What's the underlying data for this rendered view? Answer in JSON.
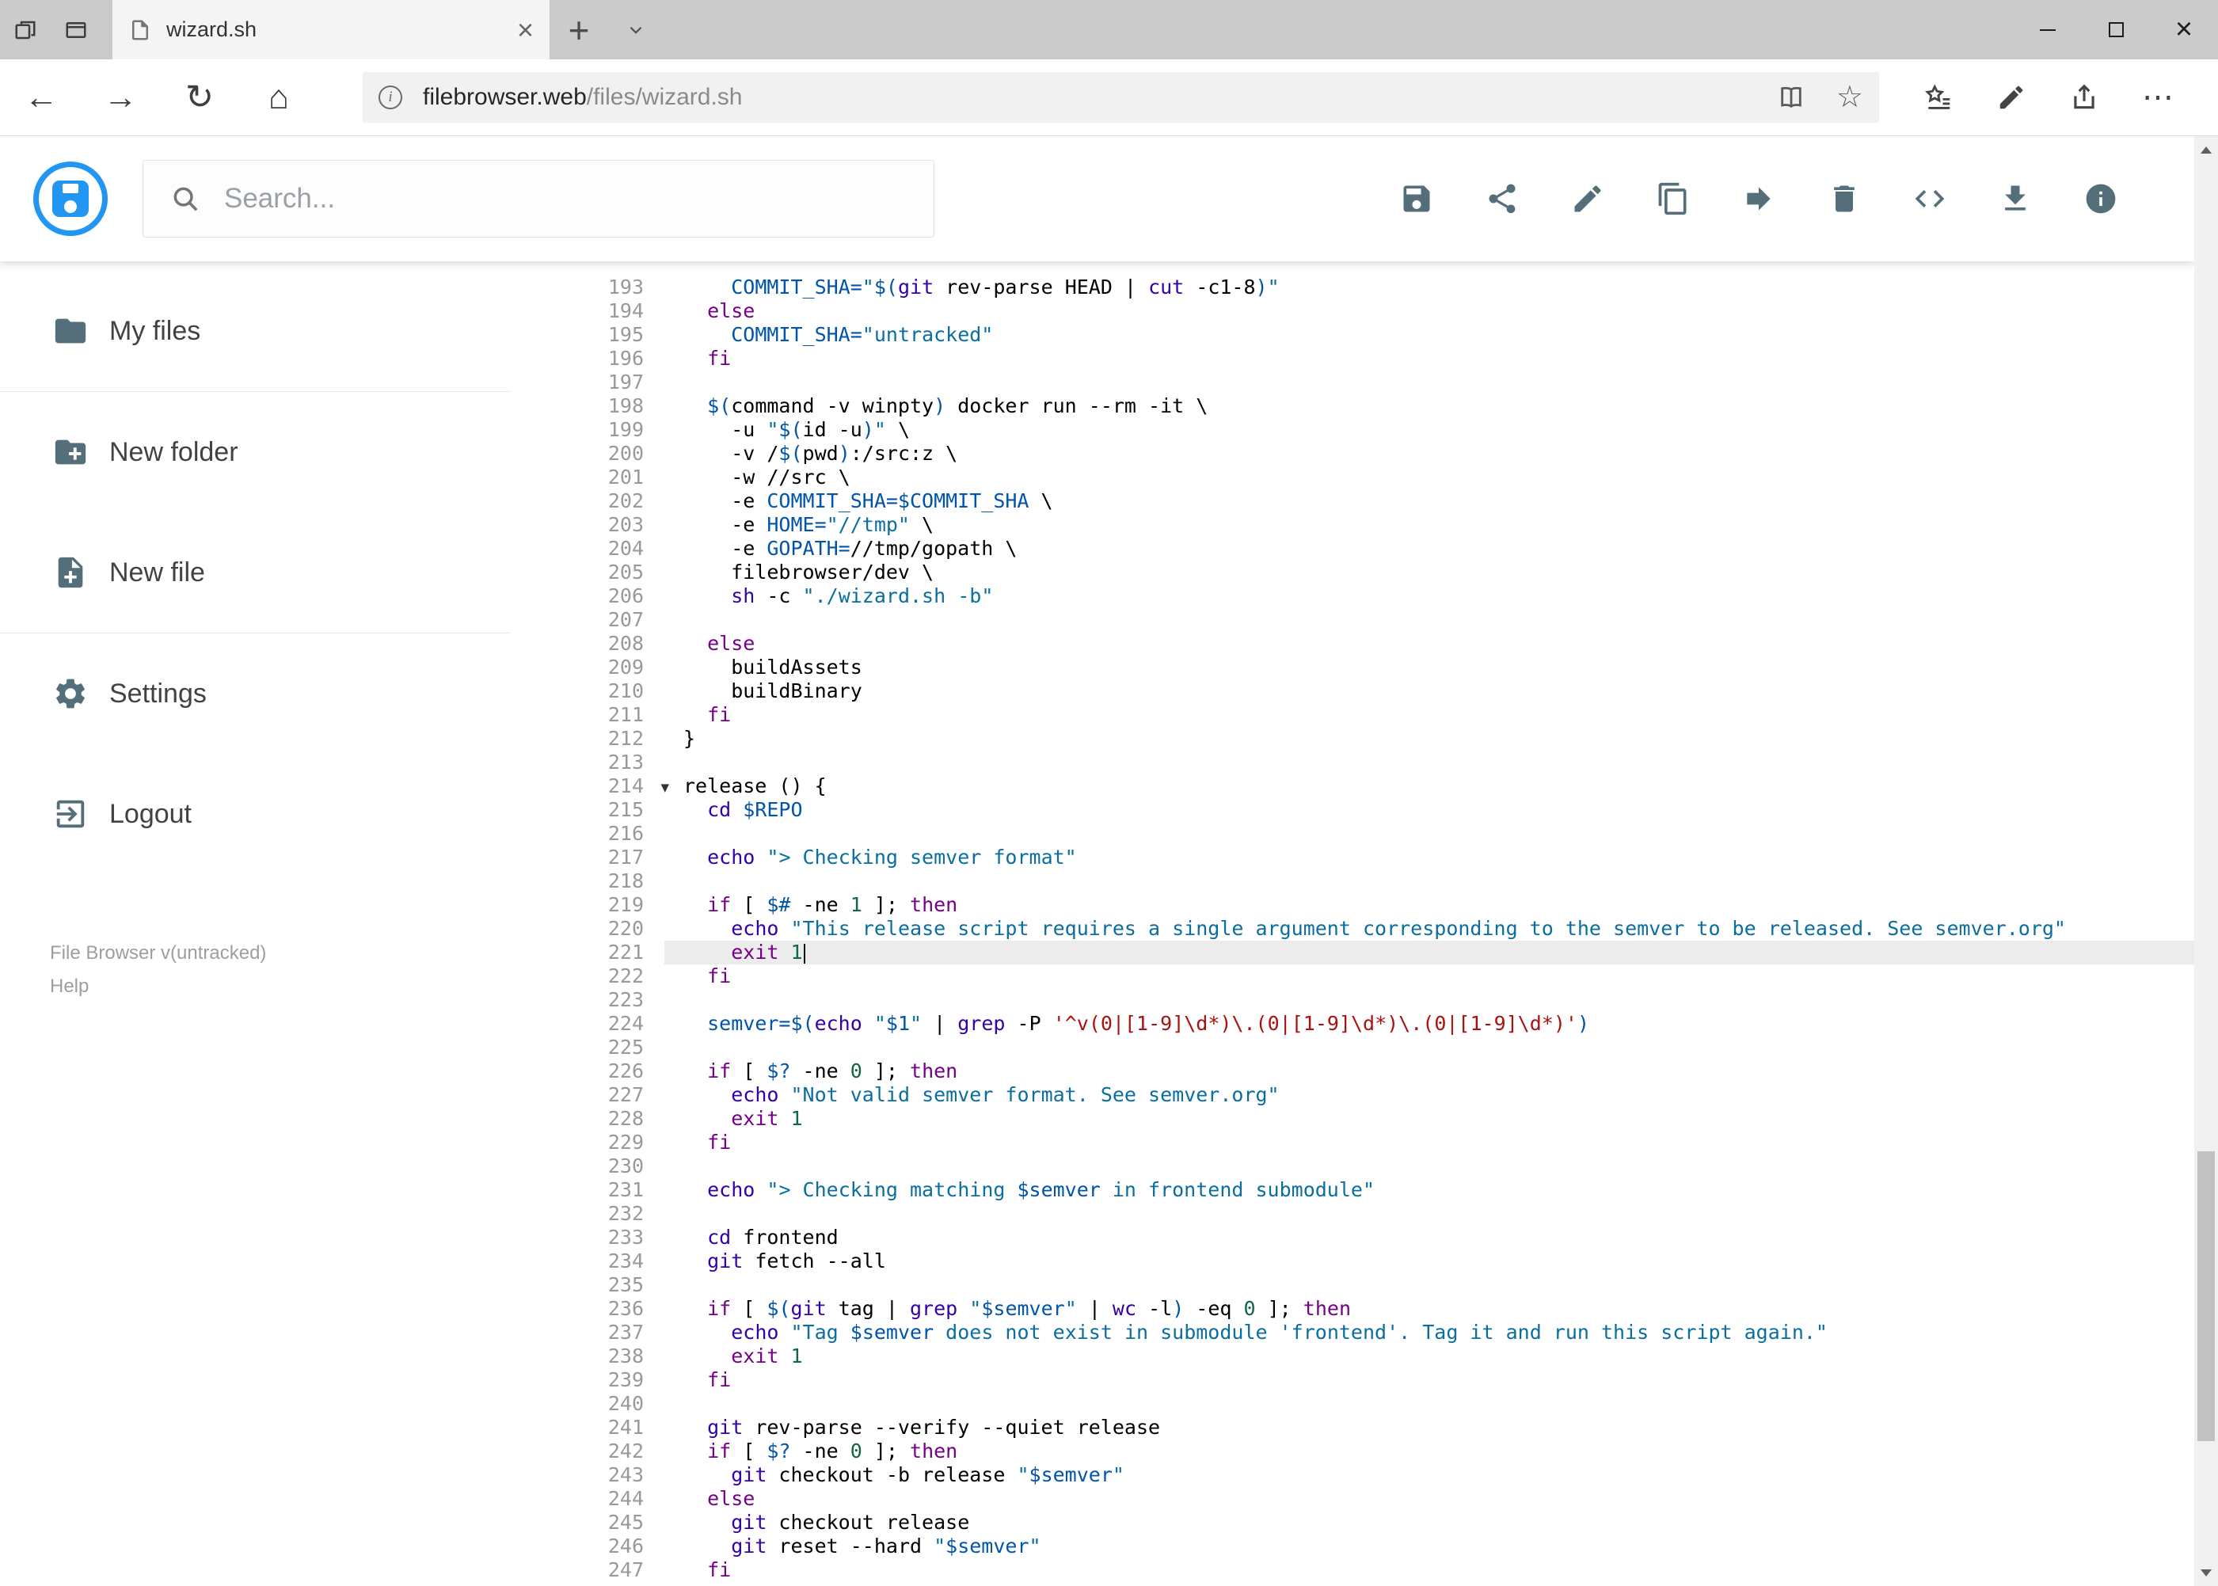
{
  "browser": {
    "tab_title": "wizard.sh",
    "url_domain": "filebrowser.web",
    "url_path": "/files/wizard.sh"
  },
  "icons": {
    "tab_close": "×",
    "new_tab": "+",
    "window_close": "×",
    "back": "←",
    "forward": "→",
    "refresh": "↻",
    "home": "⌂",
    "favorite_star": "☆",
    "ellipsis": "⋯",
    "fold_marker": "▾",
    "info_i": "i"
  },
  "header": {
    "search_placeholder": "Search...",
    "actions": [
      {
        "name": "save"
      },
      {
        "name": "share"
      },
      {
        "name": "edit"
      },
      {
        "name": "copy"
      },
      {
        "name": "move"
      },
      {
        "name": "delete"
      },
      {
        "name": "code"
      },
      {
        "name": "download"
      },
      {
        "name": "info"
      }
    ]
  },
  "sidebar": {
    "items": [
      {
        "label": "My files",
        "icon": "folder"
      },
      {
        "label": "New folder",
        "icon": "folder-plus"
      },
      {
        "label": "New file",
        "icon": "file-plus"
      },
      {
        "label": "Settings",
        "icon": "gear"
      },
      {
        "label": "Logout",
        "icon": "logout"
      }
    ],
    "dividers_after": [
      0,
      2
    ],
    "version": "File Browser v(untracked)",
    "help": "Help"
  },
  "colors": {
    "brand": "#2196f3",
    "header_icon": "#546e7a",
    "active_line_bg": "#ececec",
    "gutter": "#999999",
    "token_plain": "#000000",
    "token_keyword": "#770088",
    "token_variable": "#0055aa",
    "token_string": "#0a6ea0",
    "token_string_single": "#aa1111",
    "token_builtin": "#3300aa",
    "token_number": "#116644"
  },
  "editor": {
    "active_line": 221,
    "fold_line": 214,
    "lines": [
      {
        "n": 193,
        "s": [
          [
            "    ",
            "p"
          ],
          [
            "COMMIT_SHA=",
            "v"
          ],
          [
            "\"",
            "s"
          ],
          [
            "$(",
            "v"
          ],
          [
            "git",
            "b"
          ],
          [
            " rev-parse HEAD | ",
            "p"
          ],
          [
            "cut",
            "b"
          ],
          [
            " -c1-8",
            "p"
          ],
          [
            ")",
            "v"
          ],
          [
            "\"",
            "s"
          ]
        ]
      },
      {
        "n": 194,
        "s": [
          [
            "  ",
            "p"
          ],
          [
            "else",
            "k"
          ]
        ]
      },
      {
        "n": 195,
        "s": [
          [
            "    ",
            "p"
          ],
          [
            "COMMIT_SHA=",
            "v"
          ],
          [
            "\"untracked\"",
            "s"
          ]
        ]
      },
      {
        "n": 196,
        "s": [
          [
            "  ",
            "p"
          ],
          [
            "fi",
            "k"
          ]
        ]
      },
      {
        "n": 197,
        "s": []
      },
      {
        "n": 198,
        "s": [
          [
            "  ",
            "p"
          ],
          [
            "$(",
            "v"
          ],
          [
            "command -v winpty",
            "p"
          ],
          [
            ")",
            "v"
          ],
          [
            " docker run --rm -it \\",
            "p"
          ]
        ]
      },
      {
        "n": 199,
        "s": [
          [
            "    -u ",
            "p"
          ],
          [
            "\"",
            "s"
          ],
          [
            "$(",
            "v"
          ],
          [
            "id -u",
            "p"
          ],
          [
            ")",
            "v"
          ],
          [
            "\"",
            "s"
          ],
          [
            " \\",
            "p"
          ]
        ]
      },
      {
        "n": 200,
        "s": [
          [
            "    -v /",
            "p"
          ],
          [
            "$(",
            "v"
          ],
          [
            "pwd",
            "p"
          ],
          [
            ")",
            "v"
          ],
          [
            ":/src:z \\",
            "p"
          ]
        ]
      },
      {
        "n": 201,
        "s": [
          [
            "    -w //src \\",
            "p"
          ]
        ]
      },
      {
        "n": 202,
        "s": [
          [
            "    -e ",
            "p"
          ],
          [
            "COMMIT_SHA=$COMMIT_SHA",
            "v"
          ],
          [
            " \\",
            "p"
          ]
        ]
      },
      {
        "n": 203,
        "s": [
          [
            "    -e ",
            "p"
          ],
          [
            "HOME=",
            "v"
          ],
          [
            "\"//tmp\"",
            "s"
          ],
          [
            " \\",
            "p"
          ]
        ]
      },
      {
        "n": 204,
        "s": [
          [
            "    -e ",
            "p"
          ],
          [
            "GOPATH=",
            "v"
          ],
          [
            "//tmp/gopath \\",
            "p"
          ]
        ]
      },
      {
        "n": 205,
        "s": [
          [
            "    filebrowser/dev \\",
            "p"
          ]
        ]
      },
      {
        "n": 206,
        "s": [
          [
            "    ",
            "p"
          ],
          [
            "sh",
            "b"
          ],
          [
            " -c ",
            "p"
          ],
          [
            "\"./wizard.sh -b\"",
            "s"
          ]
        ]
      },
      {
        "n": 207,
        "s": []
      },
      {
        "n": 208,
        "s": [
          [
            "  ",
            "p"
          ],
          [
            "else",
            "k"
          ]
        ]
      },
      {
        "n": 209,
        "s": [
          [
            "    buildAssets",
            "p"
          ]
        ]
      },
      {
        "n": 210,
        "s": [
          [
            "    buildBinary",
            "p"
          ]
        ]
      },
      {
        "n": 211,
        "s": [
          [
            "  ",
            "p"
          ],
          [
            "fi",
            "k"
          ]
        ]
      },
      {
        "n": 212,
        "s": [
          [
            "}",
            "p"
          ]
        ]
      },
      {
        "n": 213,
        "s": []
      },
      {
        "n": 214,
        "s": [
          [
            "release () {",
            "p"
          ]
        ]
      },
      {
        "n": 215,
        "s": [
          [
            "  ",
            "p"
          ],
          [
            "cd",
            "b"
          ],
          [
            " ",
            "p"
          ],
          [
            "$REPO",
            "v"
          ]
        ]
      },
      {
        "n": 216,
        "s": []
      },
      {
        "n": 217,
        "s": [
          [
            "  ",
            "p"
          ],
          [
            "echo",
            "b"
          ],
          [
            " ",
            "p"
          ],
          [
            "\"> Checking semver format\"",
            "s"
          ]
        ]
      },
      {
        "n": 218,
        "s": []
      },
      {
        "n": 219,
        "s": [
          [
            "  ",
            "p"
          ],
          [
            "if",
            "k"
          ],
          [
            " [ ",
            "p"
          ],
          [
            "$#",
            "v"
          ],
          [
            " -ne ",
            "p"
          ],
          [
            "1",
            "n"
          ],
          [
            " ]; ",
            "p"
          ],
          [
            "then",
            "k"
          ]
        ]
      },
      {
        "n": 220,
        "s": [
          [
            "    ",
            "p"
          ],
          [
            "echo",
            "b"
          ],
          [
            " ",
            "p"
          ],
          [
            "\"This release script requires a single argument corresponding to the semver to be released. See semver.org\"",
            "s"
          ]
        ]
      },
      {
        "n": 221,
        "s": [
          [
            "    ",
            "p"
          ],
          [
            "exit",
            "k"
          ],
          [
            " ",
            "p"
          ],
          [
            "1",
            "n"
          ]
        ]
      },
      {
        "n": 222,
        "s": [
          [
            "  ",
            "p"
          ],
          [
            "fi",
            "k"
          ]
        ]
      },
      {
        "n": 223,
        "s": []
      },
      {
        "n": 224,
        "s": [
          [
            "  ",
            "p"
          ],
          [
            "semver=",
            "v"
          ],
          [
            "$(",
            "v"
          ],
          [
            "echo",
            "b"
          ],
          [
            " ",
            "p"
          ],
          [
            "\"",
            "s"
          ],
          [
            "$1",
            "v"
          ],
          [
            "\"",
            "s"
          ],
          [
            " | ",
            "p"
          ],
          [
            "grep",
            "b"
          ],
          [
            " -P ",
            "p"
          ],
          [
            "'^v(0|[1-9]\\d*)\\.(0|[1-9]\\d*)\\.(0|[1-9]\\d*)'",
            "r"
          ],
          [
            ")",
            "v"
          ]
        ]
      },
      {
        "n": 225,
        "s": []
      },
      {
        "n": 226,
        "s": [
          [
            "  ",
            "p"
          ],
          [
            "if",
            "k"
          ],
          [
            " [ ",
            "p"
          ],
          [
            "$?",
            "v"
          ],
          [
            " -ne ",
            "p"
          ],
          [
            "0",
            "n"
          ],
          [
            " ]; ",
            "p"
          ],
          [
            "then",
            "k"
          ]
        ]
      },
      {
        "n": 227,
        "s": [
          [
            "    ",
            "p"
          ],
          [
            "echo",
            "b"
          ],
          [
            " ",
            "p"
          ],
          [
            "\"Not valid semver format. See semver.org\"",
            "s"
          ]
        ]
      },
      {
        "n": 228,
        "s": [
          [
            "    ",
            "p"
          ],
          [
            "exit",
            "k"
          ],
          [
            " ",
            "p"
          ],
          [
            "1",
            "n"
          ]
        ]
      },
      {
        "n": 229,
        "s": [
          [
            "  ",
            "p"
          ],
          [
            "fi",
            "k"
          ]
        ]
      },
      {
        "n": 230,
        "s": []
      },
      {
        "n": 231,
        "s": [
          [
            "  ",
            "p"
          ],
          [
            "echo",
            "b"
          ],
          [
            " ",
            "p"
          ],
          [
            "\"> Checking matching ",
            "s"
          ],
          [
            "$semver",
            "v"
          ],
          [
            " in frontend submodule\"",
            "s"
          ]
        ]
      },
      {
        "n": 232,
        "s": []
      },
      {
        "n": 233,
        "s": [
          [
            "  ",
            "p"
          ],
          [
            "cd",
            "b"
          ],
          [
            " frontend",
            "p"
          ]
        ]
      },
      {
        "n": 234,
        "s": [
          [
            "  ",
            "p"
          ],
          [
            "git",
            "b"
          ],
          [
            " fetch --all",
            "p"
          ]
        ]
      },
      {
        "n": 235,
        "s": []
      },
      {
        "n": 236,
        "s": [
          [
            "  ",
            "p"
          ],
          [
            "if",
            "k"
          ],
          [
            " [ ",
            "p"
          ],
          [
            "$(",
            "v"
          ],
          [
            "git",
            "b"
          ],
          [
            " tag | ",
            "p"
          ],
          [
            "grep",
            "b"
          ],
          [
            " ",
            "p"
          ],
          [
            "\"",
            "s"
          ],
          [
            "$semver",
            "v"
          ],
          [
            "\"",
            "s"
          ],
          [
            " | ",
            "p"
          ],
          [
            "wc",
            "b"
          ],
          [
            " -l",
            "p"
          ],
          [
            ")",
            "v"
          ],
          [
            " -eq ",
            "p"
          ],
          [
            "0",
            "n"
          ],
          [
            " ]; ",
            "p"
          ],
          [
            "then",
            "k"
          ]
        ]
      },
      {
        "n": 237,
        "s": [
          [
            "    ",
            "p"
          ],
          [
            "echo",
            "b"
          ],
          [
            " ",
            "p"
          ],
          [
            "\"Tag ",
            "s"
          ],
          [
            "$semver",
            "v"
          ],
          [
            " does not exist in submodule 'frontend'. Tag it and run this script again.\"",
            "s"
          ]
        ]
      },
      {
        "n": 238,
        "s": [
          [
            "    ",
            "p"
          ],
          [
            "exit",
            "k"
          ],
          [
            " ",
            "p"
          ],
          [
            "1",
            "n"
          ]
        ]
      },
      {
        "n": 239,
        "s": [
          [
            "  ",
            "p"
          ],
          [
            "fi",
            "k"
          ]
        ]
      },
      {
        "n": 240,
        "s": []
      },
      {
        "n": 241,
        "s": [
          [
            "  ",
            "p"
          ],
          [
            "git",
            "b"
          ],
          [
            " rev-parse --verify --quiet release",
            "p"
          ]
        ]
      },
      {
        "n": 242,
        "s": [
          [
            "  ",
            "p"
          ],
          [
            "if",
            "k"
          ],
          [
            " [ ",
            "p"
          ],
          [
            "$?",
            "v"
          ],
          [
            " -ne ",
            "p"
          ],
          [
            "0",
            "n"
          ],
          [
            " ]; ",
            "p"
          ],
          [
            "then",
            "k"
          ]
        ]
      },
      {
        "n": 243,
        "s": [
          [
            "    ",
            "p"
          ],
          [
            "git",
            "b"
          ],
          [
            " checkout -b release ",
            "p"
          ],
          [
            "\"",
            "s"
          ],
          [
            "$semver",
            "v"
          ],
          [
            "\"",
            "s"
          ]
        ]
      },
      {
        "n": 244,
        "s": [
          [
            "  ",
            "p"
          ],
          [
            "else",
            "k"
          ]
        ]
      },
      {
        "n": 245,
        "s": [
          [
            "    ",
            "p"
          ],
          [
            "git",
            "b"
          ],
          [
            " checkout release",
            "p"
          ]
        ]
      },
      {
        "n": 246,
        "s": [
          [
            "    ",
            "p"
          ],
          [
            "git",
            "b"
          ],
          [
            " reset --hard ",
            "p"
          ],
          [
            "\"",
            "s"
          ],
          [
            "$semver",
            "v"
          ],
          [
            "\"",
            "s"
          ]
        ]
      },
      {
        "n": 247,
        "s": [
          [
            "  ",
            "p"
          ],
          [
            "fi",
            "k"
          ]
        ]
      }
    ]
  }
}
